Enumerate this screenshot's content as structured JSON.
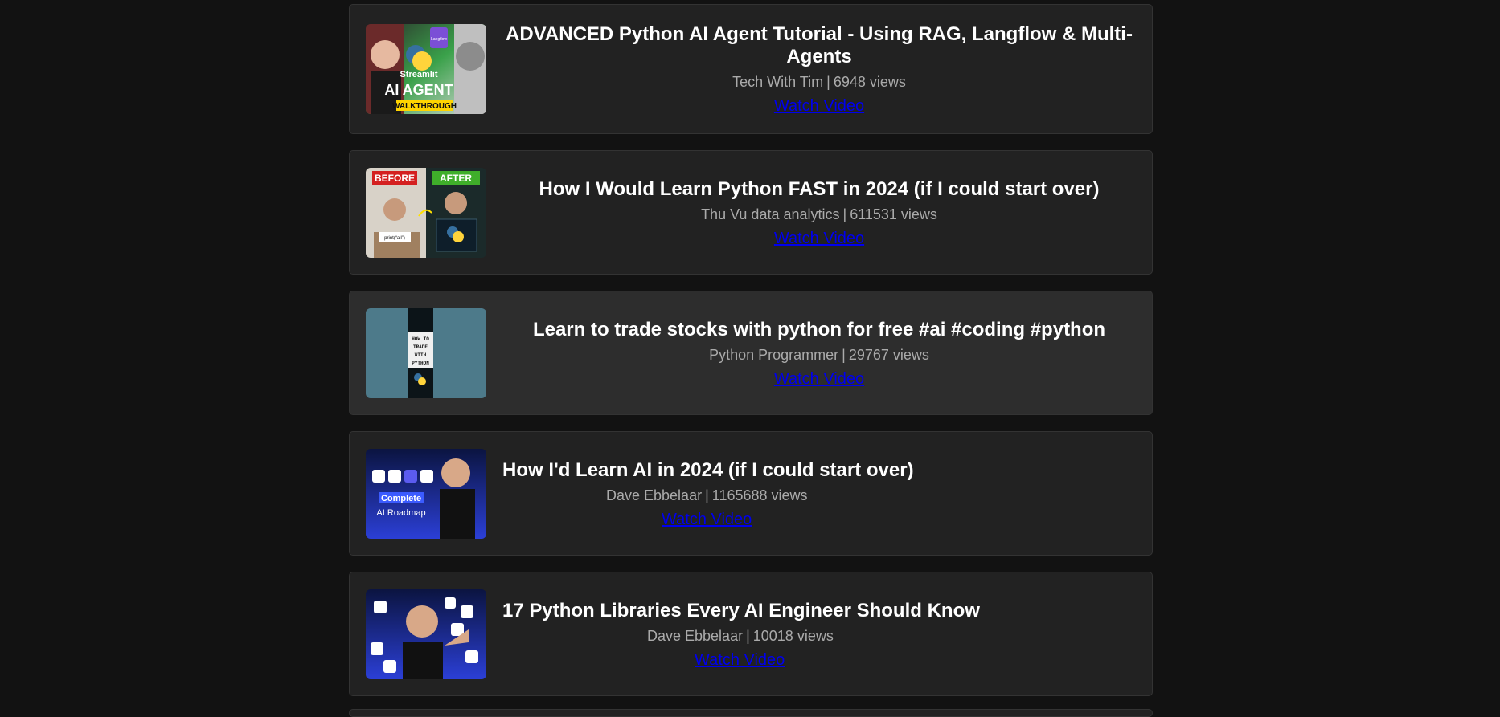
{
  "videos": [
    {
      "title": "ADVANCED Python AI Agent Tutorial - Using RAG, Langflow & Multi-Agents",
      "channel": "Tech With Tim",
      "views": "6948 views",
      "link_label": "Watch Video",
      "thumb": {
        "icon": "ai-agent-walkthrough-thumbnail",
        "text_main": "AI AGENT",
        "text_sub": "WALKTHROUGH",
        "text_top": "Streamlit",
        "text_badge": "Langflow"
      }
    },
    {
      "title": "How I Would Learn Python FAST in 2024 (if I could start over)",
      "channel": "Thu Vu data analytics",
      "views": "611531 views",
      "link_label": "Watch Video",
      "thumb": {
        "icon": "before-after-thumbnail",
        "text_left": "BEFORE",
        "text_right": "AFTER",
        "text_note": "print(“all”)"
      }
    },
    {
      "title": "Learn to trade stocks with python for free #ai #coding #python",
      "channel": "Python Programmer",
      "views": "29767 views",
      "link_label": "Watch Video",
      "thumb": {
        "icon": "trade-python-short-thumbnail",
        "text_lines": [
          "HOW TO",
          "TRADE",
          "WITH",
          "PYTHON"
        ]
      }
    },
    {
      "title": "How I'd Learn AI in 2024 (if I could start over)",
      "channel": "Dave Ebbelaar",
      "views": "1165688 views",
      "link_label": "Watch Video",
      "thumb": {
        "icon": "ai-roadmap-thumbnail",
        "text_top": "Complete",
        "text_bottom": "AI Roadmap"
      }
    },
    {
      "title": "17 Python Libraries Every AI Engineer Should Know",
      "channel": "Dave Ebbelaar",
      "views": "10018 views",
      "link_label": "Watch Video",
      "thumb": {
        "icon": "python-libraries-thumbnail"
      }
    }
  ],
  "colors": {
    "background": "#121212",
    "card": "#222222",
    "card_hover": "#2d2d2d",
    "link": "#0000ee",
    "meta": "#aaaaaa"
  }
}
